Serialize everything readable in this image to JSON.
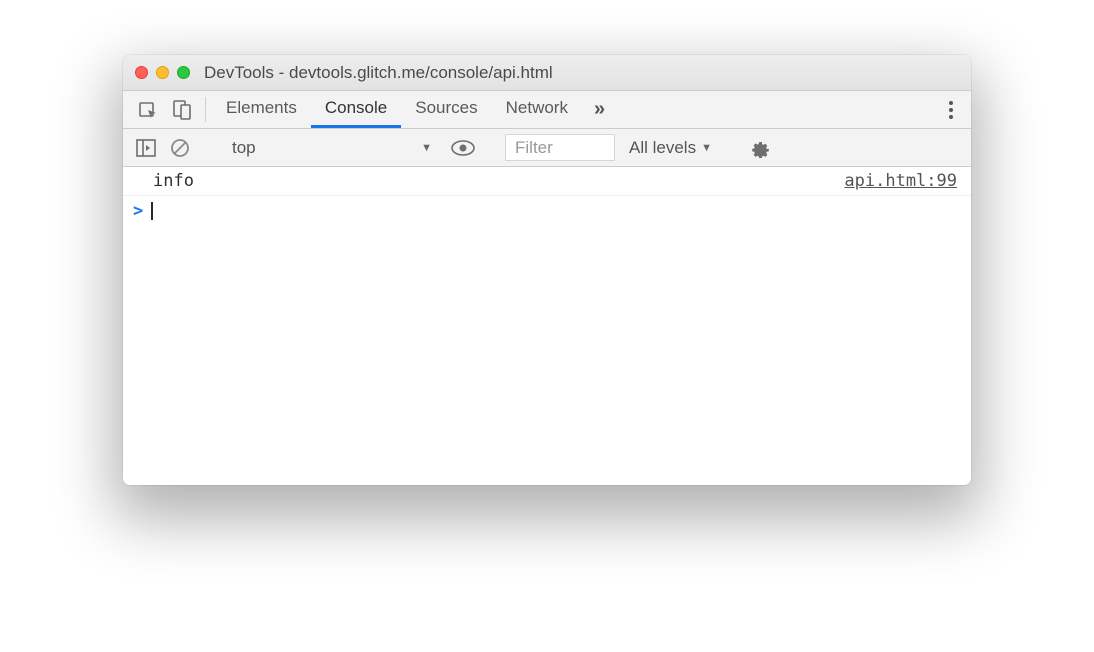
{
  "window": {
    "title": "DevTools - devtools.glitch.me/console/api.html"
  },
  "tabs": {
    "items": [
      "Elements",
      "Console",
      "Sources",
      "Network"
    ],
    "active": "Console",
    "overflow": "»"
  },
  "filterbar": {
    "context": "top",
    "filter_placeholder": "Filter",
    "levels_label": "All levels"
  },
  "console": {
    "logs": [
      {
        "message": "info",
        "source": "api.html:99"
      }
    ],
    "prompt": ">"
  }
}
